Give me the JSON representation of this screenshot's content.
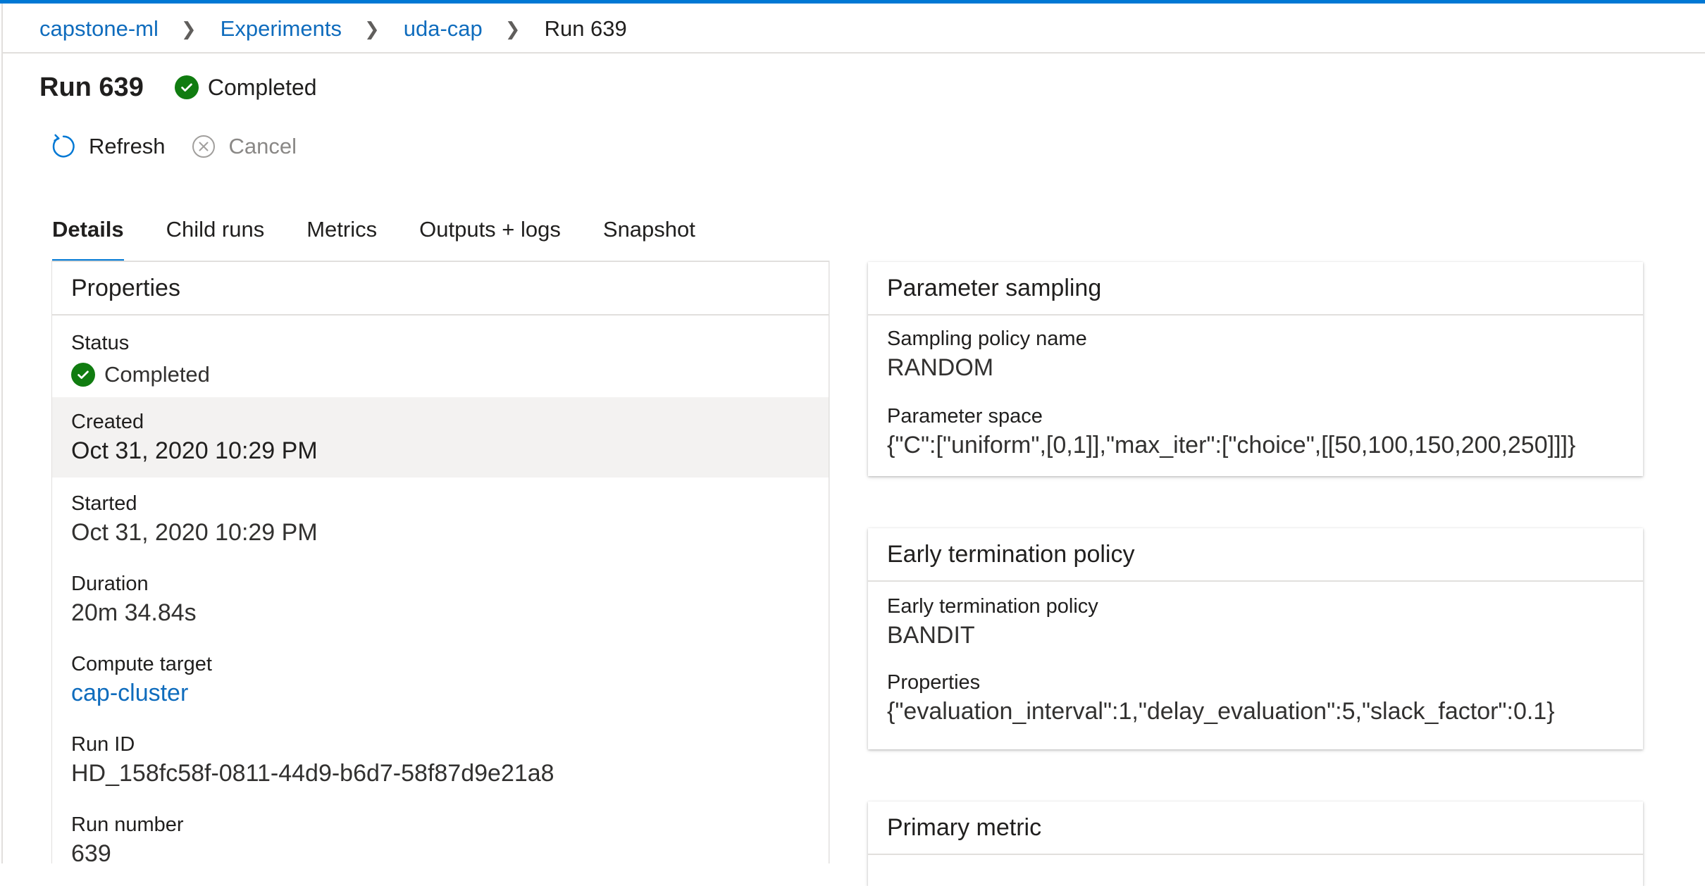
{
  "breadcrumb": {
    "items": [
      "capstone-ml",
      "Experiments",
      "uda-cap"
    ],
    "current": "Run 639"
  },
  "header": {
    "title": "Run 639",
    "status": "Completed"
  },
  "commands": {
    "refresh": "Refresh",
    "cancel": "Cancel"
  },
  "tabs": [
    {
      "label": "Details",
      "active": true
    },
    {
      "label": "Child runs"
    },
    {
      "label": "Metrics"
    },
    {
      "label": "Outputs + logs"
    },
    {
      "label": "Snapshot"
    }
  ],
  "properties": {
    "title": "Properties",
    "status_label": "Status",
    "status_value": "Completed",
    "created_label": "Created",
    "created_value": "Oct 31, 2020 10:29 PM",
    "started_label": "Started",
    "started_value": "Oct 31, 2020 10:29 PM",
    "duration_label": "Duration",
    "duration_value": "20m 34.84s",
    "compute_label": "Compute target",
    "compute_value": "cap-cluster",
    "runid_label": "Run ID",
    "runid_value": "HD_158fc58f-0811-44d9-b6d7-58f87d9e21a8",
    "runnumber_label": "Run number",
    "runnumber_value": "639"
  },
  "sampling": {
    "title": "Parameter sampling",
    "policy_label": "Sampling policy name",
    "policy_value": "RANDOM",
    "space_label": "Parameter space",
    "space_value": "{\"C\":[\"uniform\",[0,1]],\"max_iter\":[\"choice\",[[50,100,150,200,250]]]}"
  },
  "termination": {
    "title": "Early termination policy",
    "policy_label": "Early termination policy",
    "policy_value": "BANDIT",
    "properties_label": "Properties",
    "properties_value": "{\"evaluation_interval\":1,\"delay_evaluation\":5,\"slack_factor\":0.1}"
  },
  "primary": {
    "title": "Primary metric"
  },
  "colors": {
    "accent": "#0078d4",
    "link": "#0f6cbd",
    "success": "#107c10",
    "highlight_row": "#f3f2f1"
  },
  "icons": {
    "status": "check-circle-icon",
    "refresh": "refresh-icon",
    "cancel": "cancel-circle-icon",
    "separator": "chevron-right-icon"
  }
}
